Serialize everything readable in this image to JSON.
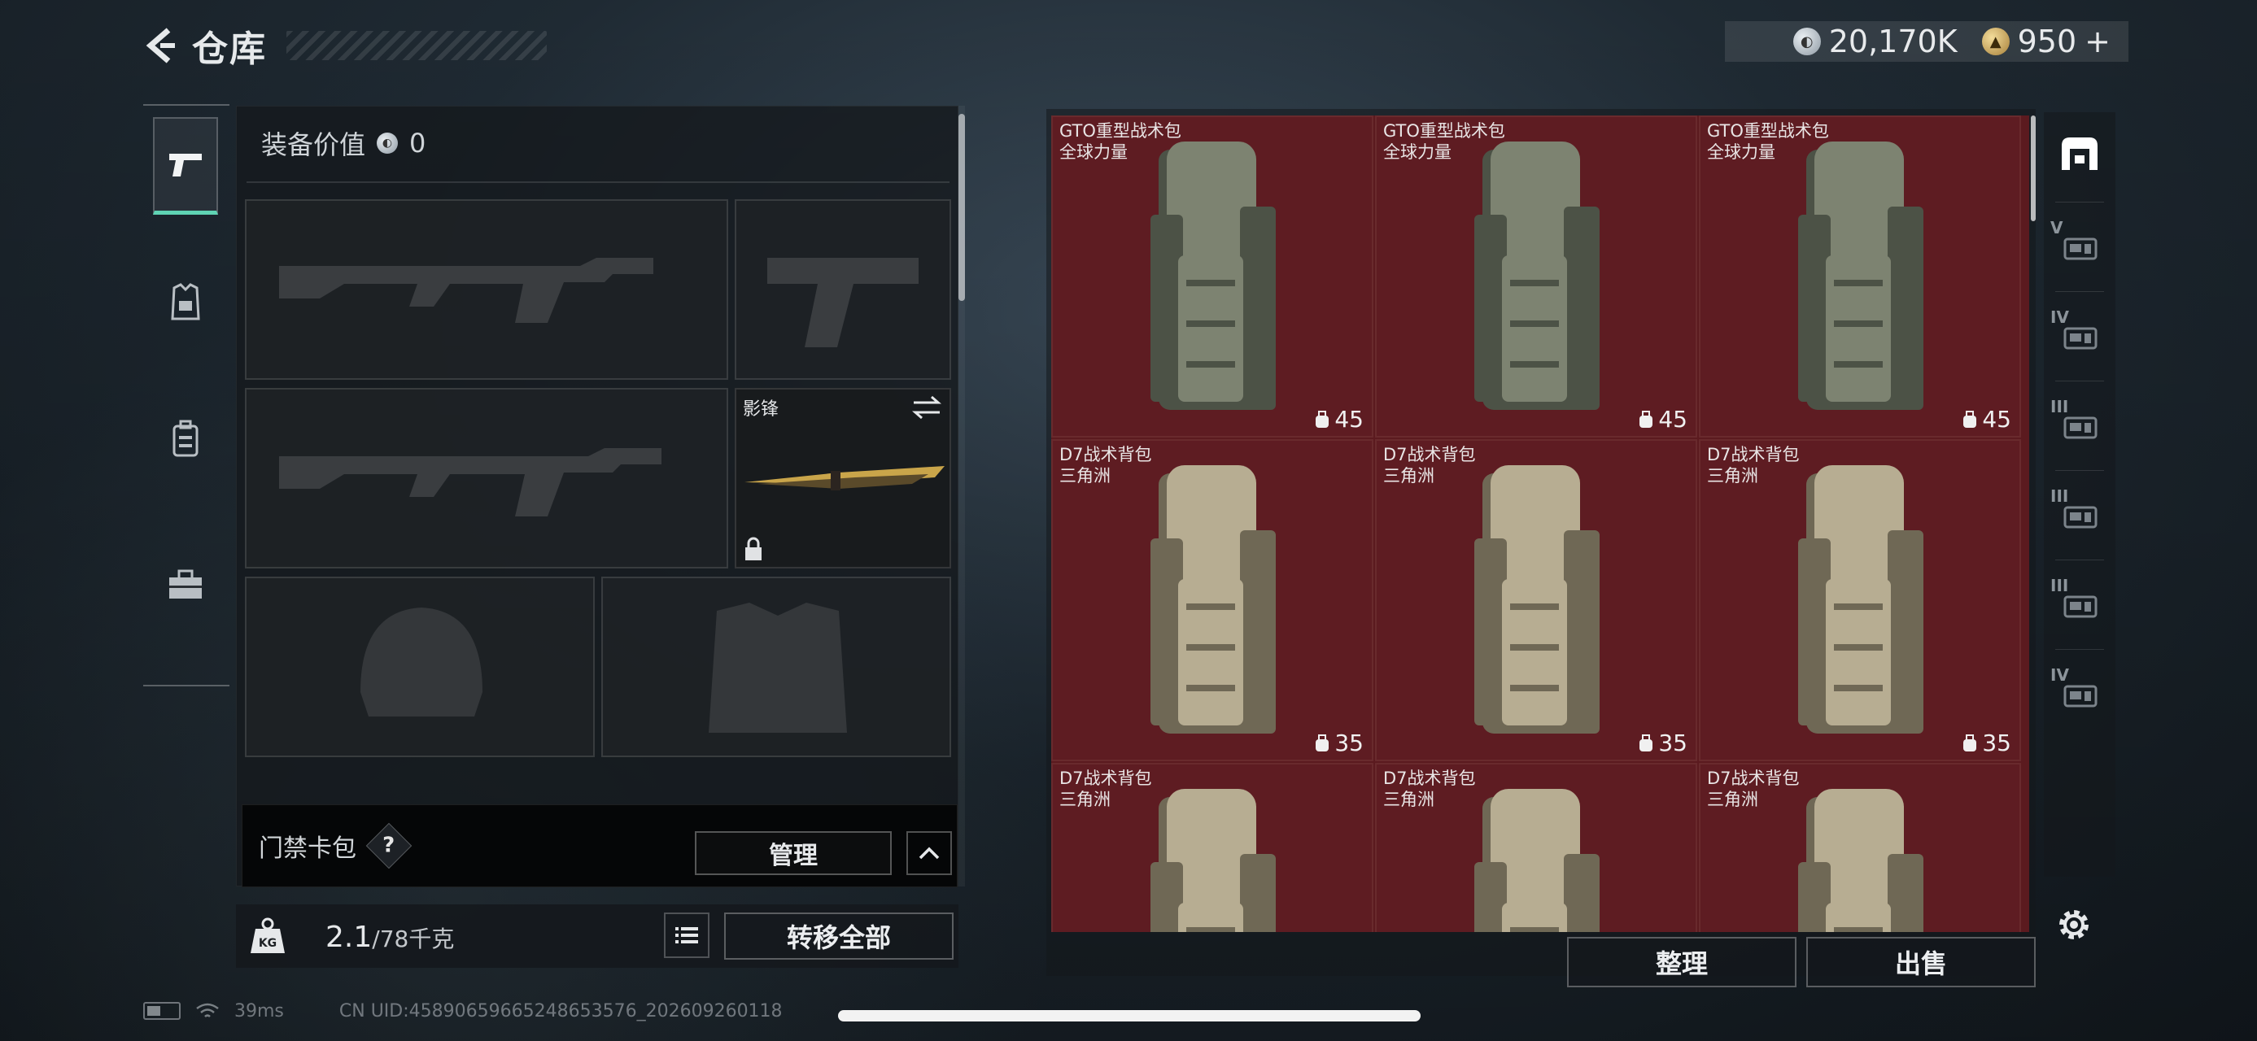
{
  "header": {
    "back_icon": "chevron-left-icon",
    "title": "仓库"
  },
  "currency": {
    "silver_amount": "20,170K",
    "gold_amount": "950",
    "gold_plus": "+"
  },
  "left_rail": {
    "items": [
      {
        "name": "weapons",
        "icon": "pistol-icon",
        "active": true
      },
      {
        "name": "armor",
        "icon": "vest-icon",
        "active": false
      },
      {
        "name": "backpack",
        "icon": "backpack-icon",
        "active": false
      },
      {
        "name": "toolbox",
        "icon": "toolbox-icon",
        "active": false
      }
    ]
  },
  "equipment": {
    "value_label": "装备价值",
    "value_amount": "0",
    "melee_slot_label": "影锋",
    "keycard_label": "门禁卡包",
    "help_symbol": "?",
    "manage_label": "管理",
    "weight_current": "2.1",
    "weight_max": "/78千克",
    "kg_label": "KG",
    "transfer_all_label": "转移全部"
  },
  "storage": {
    "items": [
      {
        "name": "GTO重型战术包",
        "brand": "全球力量",
        "capacity": "45"
      },
      {
        "name": "GTO重型战术包",
        "brand": "全球力量",
        "capacity": "45"
      },
      {
        "name": "GTO重型战术包",
        "brand": "全球力量",
        "capacity": "45"
      },
      {
        "name": "D7战术背包",
        "brand": "三角洲",
        "capacity": "35"
      },
      {
        "name": "D7战术背包",
        "brand": "三角洲",
        "capacity": "35"
      },
      {
        "name": "D7战术背包",
        "brand": "三角洲",
        "capacity": "35"
      },
      {
        "name": "D7战术背包",
        "brand": "三角洲",
        "capacity": ""
      },
      {
        "name": "D7战术背包",
        "brand": "三角洲",
        "capacity": ""
      },
      {
        "name": "D7战术背包",
        "brand": "三角洲",
        "capacity": ""
      }
    ],
    "sort_label": "整理",
    "sell_label": "出售"
  },
  "filters": {
    "levels": [
      "",
      "V",
      "IV",
      "III",
      "III",
      "III",
      "IV"
    ]
  },
  "status_bar": {
    "ping": "39ms",
    "uid": "CN UID:4589065966524865357​6_202609260118"
  },
  "colors": {
    "accent_teal": "#5fd3b4",
    "storage_cell_red": "#5e1c22"
  }
}
